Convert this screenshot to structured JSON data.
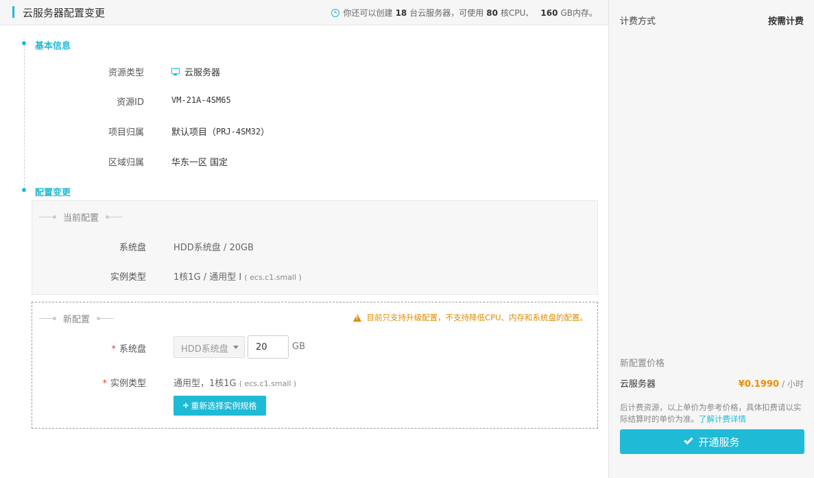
{
  "header": {
    "title": "云服务器配置变更",
    "quota": {
      "prefix": "你还可以创建",
      "servers": "18",
      "servers_suffix": "台云服务器，可使用",
      "cpu": "80",
      "cpu_suffix": "核CPU、",
      "memory": "160",
      "memory_suffix": "GB内存。"
    }
  },
  "basic_info": {
    "section_title": "基本信息",
    "resource_type": {
      "label": "资源类型",
      "value": "云服务器",
      "icon": "monitor-icon"
    },
    "resource_id": {
      "label": "资源ID",
      "value": "VM-21A-4SM65"
    },
    "project": {
      "label": "项目归属",
      "value": "默认项目（",
      "code": "PRJ-4SM32",
      "close": "）"
    },
    "region": {
      "label": "区域归属",
      "value": "华东一区  国定"
    }
  },
  "config_change": {
    "section_title": "配置变更",
    "current": {
      "legend": "当前配置",
      "disk": {
        "label": "系统盘",
        "value": "HDD系统盘 / 20GB"
      },
      "instance": {
        "label": "实例类型",
        "value": "1核1G /  通用型 I",
        "detail": "( ecs.c1.small )"
      }
    },
    "new": {
      "legend": "新配置",
      "warning": "目前只支持升级配置，不支持降低CPU、内存和系统盘的配置。",
      "disk": {
        "label": "系统盘",
        "select_value": "HDD系统盘",
        "size": "20",
        "unit": "GB"
      },
      "instance": {
        "label": "实例类型",
        "value": "通用型，1核1G",
        "detail": "( ecs.c1.small )"
      },
      "reselect_button": "重新选择实例规格",
      "required_mark": "*"
    }
  },
  "sidebar": {
    "billing_label": "计费方式",
    "billing_value": "按需计费",
    "price_title": "新配置价格",
    "item_label": "云服务器",
    "price": "¥0.1990",
    "price_unit": "/ 小时",
    "note": "后计费资源，以上单价为参考价格，具体扣费请以实际结算时的单价为准。",
    "note_link": "了解计费详情",
    "open_button": "开通服务"
  },
  "colors": {
    "accent": "#1fbad6",
    "warning": "#e08a00",
    "price": "#f08c00",
    "required": "#e0403b"
  }
}
